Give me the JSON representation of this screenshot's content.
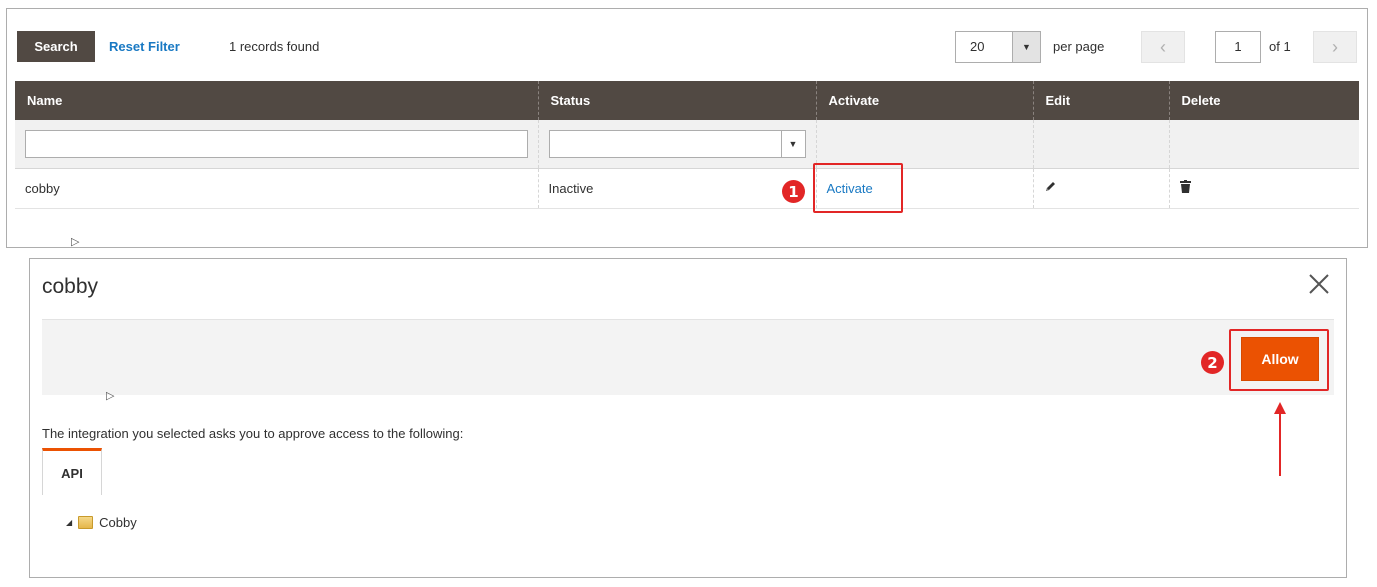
{
  "toolbar": {
    "search_label": "Search",
    "reset_label": "Reset Filter",
    "records_text": "1 records found",
    "per_page_value": "20",
    "per_page_label": "per page",
    "page_current": "1",
    "page_of": "of 1"
  },
  "grid": {
    "columns": [
      "Name",
      "Status",
      "Activate",
      "Edit",
      "Delete"
    ],
    "rows": [
      {
        "name": "cobby",
        "status": "Inactive",
        "activate": "Activate"
      }
    ]
  },
  "annotations": {
    "step1": "1",
    "step2": "2",
    "highlight_color": "#e22626"
  },
  "modal": {
    "title": "cobby",
    "allow_label": "Allow",
    "description": "The integration you selected asks you to approve access to the following:",
    "tab_label": "API",
    "tree_item": "Cobby"
  },
  "colors": {
    "header_bg": "#514943",
    "link": "#1979c3",
    "accent_orange": "#eb5202"
  },
  "icons": {
    "pager_prev": "chevron-left-icon",
    "pager_next": "chevron-right-icon",
    "edit": "pencil-icon",
    "delete": "trash-icon",
    "close": "close-icon",
    "tree_folder": "folder-icon"
  }
}
